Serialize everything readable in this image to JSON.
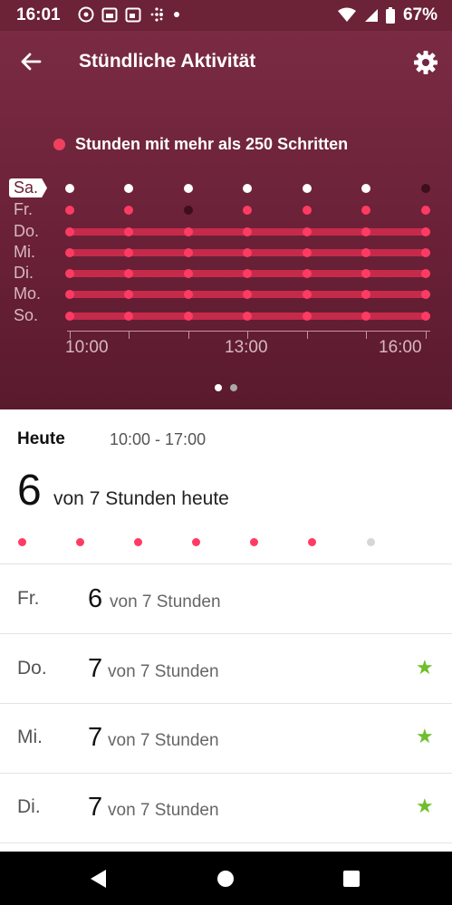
{
  "status_bar": {
    "time": "16:01",
    "battery": "67%",
    "icons": [
      "whatsapp-icon",
      "calendar-icon",
      "calendar-icon",
      "fitbit-icon",
      "dot-icon",
      "wifi-icon",
      "signal-icon",
      "battery-icon"
    ]
  },
  "app_bar": {
    "title": "Stündliche Aktivität",
    "back_icon": "back-arrow-icon",
    "settings_icon": "gear-icon"
  },
  "chart": {
    "legend": "Stunden mit mehr als 250 Schritten",
    "accent": "#ff3b63",
    "days": [
      {
        "label": "Sa.",
        "active": true,
        "bar": false,
        "hours": [
          "white",
          "white",
          "white",
          "white",
          "white",
          "white",
          "dim"
        ]
      },
      {
        "label": "Fr.",
        "active": false,
        "bar": false,
        "hours": [
          "red",
          "red",
          "dim",
          "red",
          "red",
          "red",
          "red"
        ]
      },
      {
        "label": "Do.",
        "active": false,
        "bar": true,
        "hours": [
          "red",
          "red",
          "red",
          "red",
          "red",
          "red",
          "red"
        ]
      },
      {
        "label": "Mi.",
        "active": false,
        "bar": true,
        "hours": [
          "red",
          "red",
          "red",
          "red",
          "red",
          "red",
          "red"
        ]
      },
      {
        "label": "Di.",
        "active": false,
        "bar": true,
        "hours": [
          "red",
          "red",
          "red",
          "red",
          "red",
          "red",
          "red"
        ]
      },
      {
        "label": "Mo.",
        "active": false,
        "bar": true,
        "hours": [
          "red",
          "red",
          "red",
          "red",
          "red",
          "red",
          "red"
        ]
      },
      {
        "label": "So.",
        "active": false,
        "bar": true,
        "hours": [
          "red",
          "red",
          "red",
          "red",
          "red",
          "red",
          "red"
        ]
      }
    ],
    "x_labels": [
      "10:00",
      "13:00",
      "16:00"
    ],
    "page_indicator": {
      "count": 2,
      "active": 0
    }
  },
  "today": {
    "label": "Heute",
    "range": "10:00 - 17:00",
    "count": "6",
    "summary": "von 7 Stunden heute",
    "hours": [
      "active",
      "active",
      "active",
      "active",
      "active",
      "active",
      "inactive"
    ]
  },
  "history": [
    {
      "day": "Fr.",
      "count": "6",
      "text": "von 7 Stunden",
      "star": false
    },
    {
      "day": "Do.",
      "count": "7",
      "text": "von 7 Stunden",
      "star": true
    },
    {
      "day": "Mi.",
      "count": "7",
      "text": "von 7 Stunden",
      "star": true
    },
    {
      "day": "Di.",
      "count": "7",
      "text": "von 7 Stunden",
      "star": true
    }
  ],
  "colors": {
    "hero": "#6a2137",
    "star": "#6ebe2d",
    "inactive_dot": "#d6d6d6"
  }
}
